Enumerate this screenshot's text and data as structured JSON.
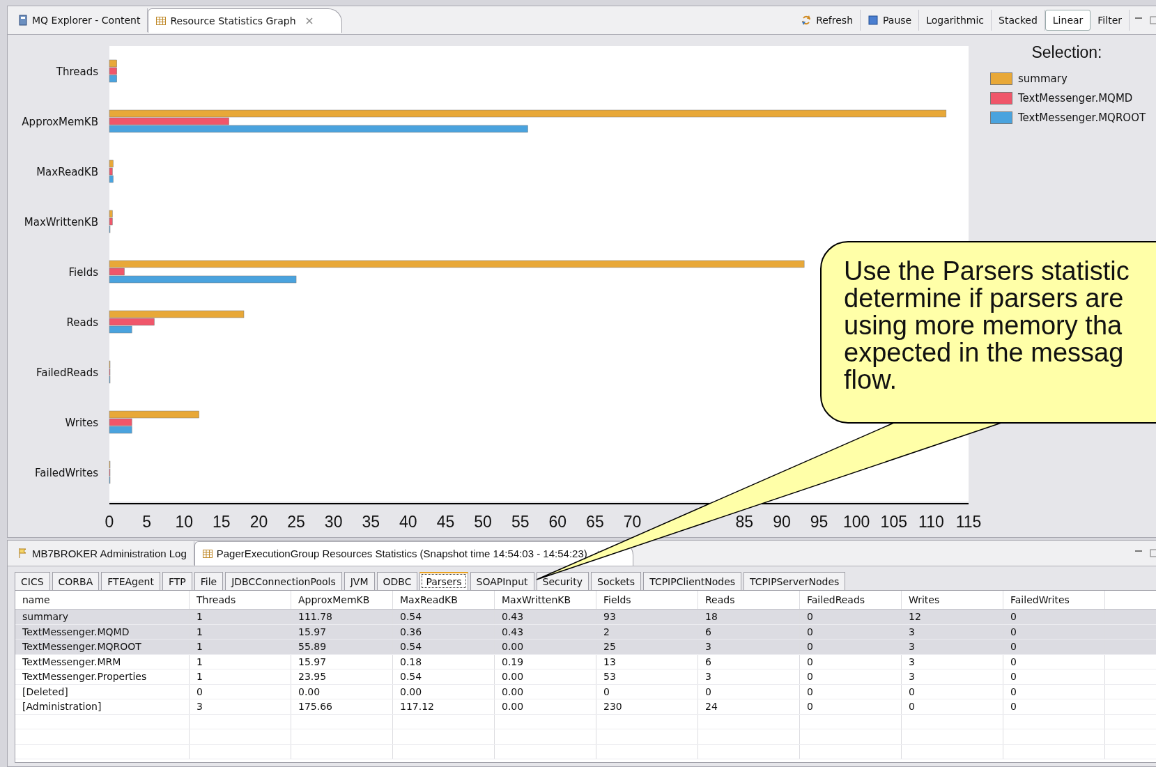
{
  "top_tabs": [
    {
      "label": "MQ Explorer - Content",
      "kind": "book",
      "selected": false,
      "closable": false
    },
    {
      "label": "Resource Statistics Graph",
      "kind": "table",
      "selected": true,
      "closable": true
    }
  ],
  "toolbar": [
    {
      "label": "Refresh",
      "kind": "refresh",
      "selected": false
    },
    {
      "label": "Pause",
      "kind": "pause",
      "selected": false
    },
    {
      "label": "Logarithmic",
      "kind": "text",
      "selected": false
    },
    {
      "label": "Stacked",
      "kind": "text",
      "selected": false
    },
    {
      "label": "Linear",
      "kind": "text",
      "selected": true
    },
    {
      "label": "Filter",
      "kind": "text",
      "selected": false
    }
  ],
  "chart_data": {
    "type": "bar",
    "orientation": "horizontal",
    "categories": [
      "Threads",
      "ApproxMemKB",
      "MaxReadKB",
      "MaxWrittenKB",
      "Fields",
      "Reads",
      "FailedReads",
      "Writes",
      "FailedWrites"
    ],
    "series": [
      {
        "name": "summary",
        "color": "#e8a838",
        "values": [
          1,
          112,
          0.5,
          0.4,
          93,
          18,
          0,
          12,
          0
        ]
      },
      {
        "name": "TextMessenger.MQMD",
        "color": "#f0566a",
        "values": [
          1,
          16,
          0.4,
          0.4,
          2,
          6,
          0,
          3,
          0
        ]
      },
      {
        "name": "TextMessenger.MQROOT",
        "color": "#4aa3de",
        "values": [
          1,
          56,
          0.5,
          0,
          25,
          3,
          0,
          3,
          0
        ]
      }
    ],
    "xlim": [
      0,
      115
    ],
    "xticks": [
      0,
      5,
      10,
      15,
      20,
      25,
      30,
      35,
      40,
      45,
      50,
      55,
      60,
      65,
      70,
      85,
      90,
      95,
      100,
      105,
      110,
      115
    ]
  },
  "legend": {
    "title": "Selection:"
  },
  "callout": {
    "text": "Use the Parsers statistic\ndetermine if parsers are\nusing more memory tha\nexpected in the messag\nflow."
  },
  "bottom_tabs": [
    {
      "label": "MB7BROKER  Administration Log",
      "kind": "flag",
      "selected": false,
      "closable": false
    },
    {
      "label": "PagerExecutionGroup Resources Statistics (Snapshot time 14:54:03 - 14:54:23)",
      "kind": "table",
      "selected": true,
      "closable": true
    }
  ],
  "resource_tabs": [
    {
      "label": "CICS",
      "selected": false
    },
    {
      "label": "CORBA",
      "selected": false
    },
    {
      "label": "FTEAgent",
      "selected": false
    },
    {
      "label": "FTP",
      "selected": false
    },
    {
      "label": "File",
      "selected": false
    },
    {
      "label": "JDBCConnectionPools",
      "selected": false
    },
    {
      "label": "JVM",
      "selected": false
    },
    {
      "label": "ODBC",
      "selected": false
    },
    {
      "label": "Parsers",
      "selected": true
    },
    {
      "label": "SOAPInput",
      "selected": false
    },
    {
      "label": "Security",
      "selected": false
    },
    {
      "label": "Sockets",
      "selected": false
    },
    {
      "label": "TCPIPClientNodes",
      "selected": false
    },
    {
      "label": "TCPIPServerNodes",
      "selected": false
    }
  ],
  "table": {
    "columns": [
      "name",
      "Threads",
      "ApproxMemKB",
      "MaxReadKB",
      "MaxWrittenKB",
      "Fields",
      "Reads",
      "FailedReads",
      "Writes",
      "FailedWrites"
    ],
    "rows": [
      {
        "selected": true,
        "cells": [
          "summary",
          "1",
          "111.78",
          "0.54",
          "0.43",
          "93",
          "18",
          "0",
          "12",
          "0"
        ]
      },
      {
        "selected": true,
        "cells": [
          "TextMessenger.MQMD",
          "1",
          "15.97",
          "0.36",
          "0.43",
          "2",
          "6",
          "0",
          "3",
          "0"
        ]
      },
      {
        "selected": true,
        "cells": [
          "TextMessenger.MQROOT",
          "1",
          "55.89",
          "0.54",
          "0.00",
          "25",
          "3",
          "0",
          "3",
          "0"
        ]
      },
      {
        "selected": false,
        "cells": [
          "TextMessenger.MRM",
          "1",
          "15.97",
          "0.18",
          "0.19",
          "13",
          "6",
          "0",
          "3",
          "0"
        ]
      },
      {
        "selected": false,
        "cells": [
          "TextMessenger.Properties",
          "1",
          "23.95",
          "0.54",
          "0.00",
          "53",
          "3",
          "0",
          "3",
          "0"
        ]
      },
      {
        "selected": false,
        "cells": [
          "[Deleted]",
          "0",
          "0.00",
          "0.00",
          "0.00",
          "0",
          "0",
          "0",
          "0",
          "0"
        ]
      },
      {
        "selected": false,
        "cells": [
          "[Administration]",
          "3",
          "175.66",
          "117.12",
          "0.00",
          "230",
          "24",
          "0",
          "0",
          "0"
        ]
      }
    ]
  }
}
